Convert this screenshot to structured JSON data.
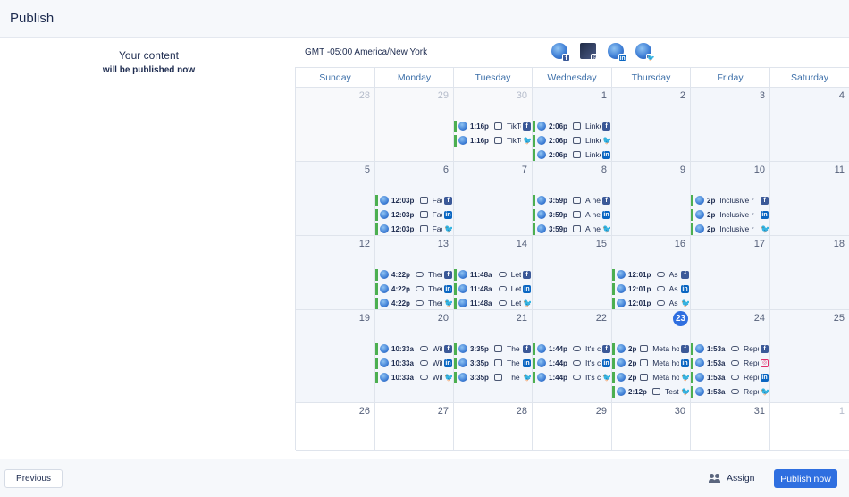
{
  "header": {
    "title": "Publish"
  },
  "left_panel": {
    "line1": "Your content",
    "line2": "will be published now"
  },
  "timezone": "GMT -05:00 America/New York",
  "accounts": [
    {
      "network": "facebook",
      "badge": "f"
    },
    {
      "network": "instagram",
      "badge": "◎"
    },
    {
      "network": "linkedin",
      "badge": "in"
    },
    {
      "network": "twitter",
      "badge": "🐦"
    }
  ],
  "calendar": {
    "weekdays": [
      "Sunday",
      "Monday",
      "Tuesday",
      "Wednesday",
      "Thursday",
      "Friday",
      "Saturday"
    ],
    "today": "23",
    "weeks": [
      [
        {
          "day": "28",
          "other": true,
          "events": []
        },
        {
          "day": "29",
          "other": true,
          "events": []
        },
        {
          "day": "30",
          "other": true,
          "events": [
            {
              "time": "1:16p",
              "type": "image",
              "title": "TikTok",
              "network": "facebook"
            },
            {
              "time": "1:16p",
              "type": "image",
              "title": "TikTok",
              "network": "twitter"
            }
          ]
        },
        {
          "day": "1",
          "events": [
            {
              "time": "2:06p",
              "type": "image",
              "title": "Linke",
              "network": "facebook"
            },
            {
              "time": "2:06p",
              "type": "image",
              "title": "Linke",
              "network": "twitter"
            },
            {
              "time": "2:06p",
              "type": "image",
              "title": "Linke",
              "network": "linkedin"
            }
          ]
        },
        {
          "day": "2",
          "events": []
        },
        {
          "day": "3",
          "events": []
        },
        {
          "day": "4",
          "events": []
        }
      ],
      [
        {
          "day": "5",
          "events": []
        },
        {
          "day": "6",
          "events": [
            {
              "time": "12:03p",
              "type": "image",
              "title": "Face",
              "network": "facebook"
            },
            {
              "time": "12:03p",
              "type": "image",
              "title": "Face",
              "network": "linkedin"
            },
            {
              "time": "12:03p",
              "type": "image",
              "title": "Face",
              "network": "twitter"
            }
          ]
        },
        {
          "day": "7",
          "events": []
        },
        {
          "day": "8",
          "events": [
            {
              "time": "3:59p",
              "type": "image",
              "title": "A nev",
              "network": "facebook"
            },
            {
              "time": "3:59p",
              "type": "image",
              "title": "A nev",
              "network": "linkedin"
            },
            {
              "time": "3:59p",
              "type": "image",
              "title": "A nev",
              "network": "twitter"
            }
          ]
        },
        {
          "day": "9",
          "events": []
        },
        {
          "day": "10",
          "events": [
            {
              "time": "2p",
              "type": "none",
              "title": "Inclusive r",
              "network": "facebook"
            },
            {
              "time": "2p",
              "type": "none",
              "title": "Inclusive r",
              "network": "linkedin"
            },
            {
              "time": "2p",
              "type": "none",
              "title": "Inclusive r",
              "network": "twitter"
            }
          ]
        },
        {
          "day": "11",
          "events": []
        }
      ],
      [
        {
          "day": "12",
          "events": []
        },
        {
          "day": "13",
          "events": [
            {
              "time": "4:22p",
              "type": "link",
              "title": "There",
              "network": "facebook"
            },
            {
              "time": "4:22p",
              "type": "link",
              "title": "There",
              "network": "linkedin"
            },
            {
              "time": "4:22p",
              "type": "link",
              "title": "There",
              "network": "twitter"
            }
          ]
        },
        {
          "day": "14",
          "events": [
            {
              "time": "11:48a",
              "type": "link",
              "title": "Let's",
              "network": "facebook"
            },
            {
              "time": "11:48a",
              "type": "link",
              "title": "Let's",
              "network": "linkedin"
            },
            {
              "time": "11:48a",
              "type": "link",
              "title": "Let's",
              "network": "twitter"
            }
          ]
        },
        {
          "day": "15",
          "events": []
        },
        {
          "day": "16",
          "events": [
            {
              "time": "12:01p",
              "type": "link",
              "title": "As th",
              "network": "facebook"
            },
            {
              "time": "12:01p",
              "type": "link",
              "title": "As th",
              "network": "linkedin"
            },
            {
              "time": "12:01p",
              "type": "link",
              "title": "As th",
              "network": "twitter"
            }
          ]
        },
        {
          "day": "17",
          "events": []
        },
        {
          "day": "18",
          "events": []
        }
      ],
      [
        {
          "day": "19",
          "events": []
        },
        {
          "day": "20",
          "events": [
            {
              "time": "10:33a",
              "type": "link",
              "title": "With",
              "network": "facebook"
            },
            {
              "time": "10:33a",
              "type": "link",
              "title": "With",
              "network": "linkedin"
            },
            {
              "time": "10:33a",
              "type": "link",
              "title": "With",
              "network": "twitter"
            }
          ]
        },
        {
          "day": "21",
          "events": [
            {
              "time": "3:35p",
              "type": "image",
              "title": "The",
              "network": "facebook"
            },
            {
              "time": "3:35p",
              "type": "image",
              "title": "The",
              "network": "linkedin"
            },
            {
              "time": "3:35p",
              "type": "image",
              "title": "The",
              "network": "twitter"
            }
          ]
        },
        {
          "day": "22",
          "events": [
            {
              "time": "1:44p",
              "type": "link",
              "title": "It's ch",
              "network": "facebook"
            },
            {
              "time": "1:44p",
              "type": "link",
              "title": "It's ch",
              "network": "linkedin"
            },
            {
              "time": "1:44p",
              "type": "link",
              "title": "It's ch",
              "network": "twitter"
            }
          ]
        },
        {
          "day": "23",
          "events": [
            {
              "time": "2p",
              "type": "image",
              "title": "Meta ho",
              "network": "facebook"
            },
            {
              "time": "2p",
              "type": "image",
              "title": "Meta ho",
              "network": "linkedin"
            },
            {
              "time": "2p",
              "type": "image",
              "title": "Meta ho",
              "network": "twitter"
            },
            {
              "time": "2:12p",
              "type": "image",
              "title": "Test f",
              "network": "twitter"
            }
          ]
        },
        {
          "day": "24",
          "events": [
            {
              "time": "1:53a",
              "type": "link",
              "title": "Repur",
              "network": "facebook"
            },
            {
              "time": "1:53a",
              "type": "link",
              "title": "Repur",
              "network": "instagram"
            },
            {
              "time": "1:53a",
              "type": "link",
              "title": "Repur",
              "network": "linkedin"
            },
            {
              "time": "1:53a",
              "type": "link",
              "title": "Repur",
              "network": "twitter"
            }
          ]
        },
        {
          "day": "25",
          "events": []
        }
      ],
      [
        {
          "day": "26",
          "events": []
        },
        {
          "day": "27",
          "events": []
        },
        {
          "day": "28",
          "events": []
        },
        {
          "day": "29",
          "events": []
        },
        {
          "day": "30",
          "events": []
        },
        {
          "day": "31",
          "events": []
        },
        {
          "day": "1",
          "other": true,
          "events": []
        }
      ]
    ]
  },
  "footer": {
    "previous_label": "Previous",
    "assign_label": "Assign",
    "publish_label": "Publish now"
  }
}
